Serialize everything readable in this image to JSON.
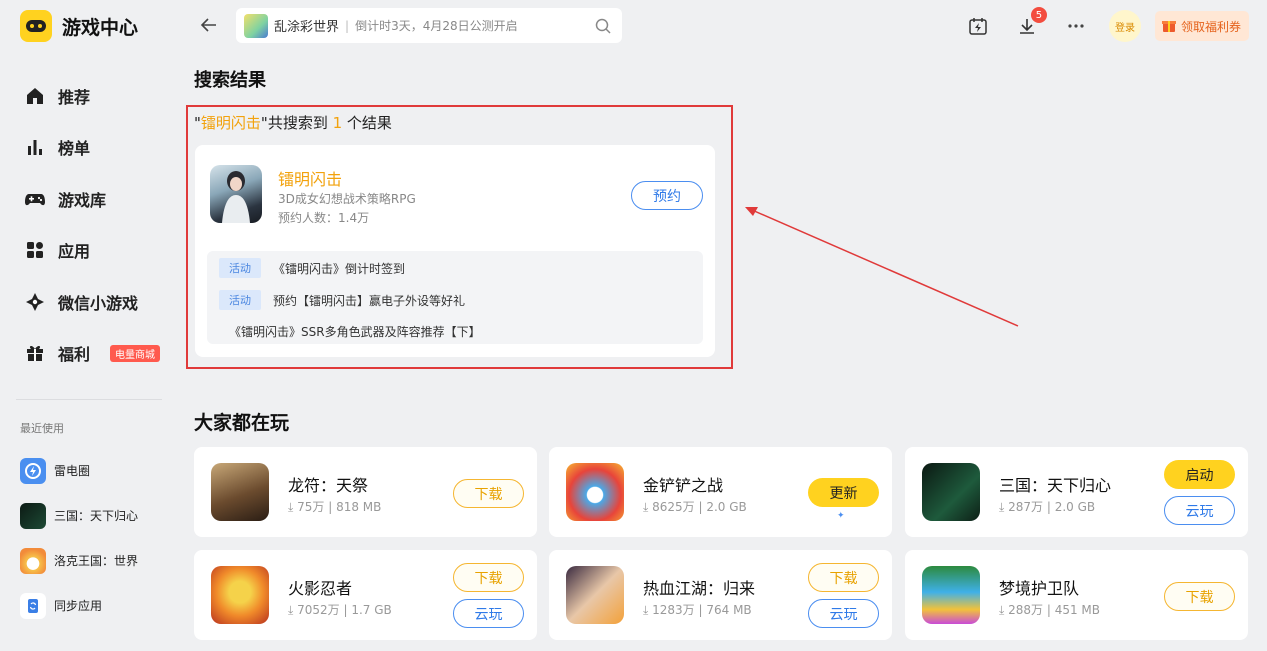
{
  "app": {
    "title": "游戏中心"
  },
  "sidebar": {
    "items": [
      {
        "label": "推荐"
      },
      {
        "label": "榜单"
      },
      {
        "label": "游戏库"
      },
      {
        "label": "应用"
      },
      {
        "label": "微信小游戏"
      },
      {
        "label": "福利",
        "badge": "电量商城"
      }
    ],
    "recent_title": "最近使用",
    "recent": [
      {
        "label": "雷电圈"
      },
      {
        "label": "三国：天下归心"
      },
      {
        "label": "洛克王国：世界"
      },
      {
        "label": "同步应用"
      }
    ]
  },
  "search": {
    "game": "乱涂彩世界",
    "hint": "倒计时3天，4月28日公测开启"
  },
  "topbar": {
    "download_count": "5",
    "login_label": "登录",
    "coupon_label": "领取福利券"
  },
  "results": {
    "title": "搜索结果",
    "summary_prefix": "\"",
    "keyword": "镭明闪击",
    "summary_mid": "\"共搜索到 ",
    "count": "1",
    "summary_suffix": " 个结果",
    "game": {
      "name": "镭明闪击",
      "subtitle": "3D成女幻想战术策略RPG",
      "reservations": "预约人数：1.4万",
      "reserve_label": "预约"
    },
    "activities": [
      {
        "tag": "活动",
        "text": "《镭明闪击》倒计时签到"
      },
      {
        "tag": "活动",
        "text": "预约【镭明闪击】赢电子外设等好礼"
      },
      {
        "tag": "",
        "text": "《镭明闪击》SSR多角色武器及阵容推荐【下】"
      }
    ]
  },
  "popular": {
    "title": "大家都在玩",
    "games": [
      {
        "name": "龙符：天祭",
        "players": "75万",
        "size": "818 MB",
        "primary": "下载",
        "secondary": ""
      },
      {
        "name": "金铲铲之战",
        "players": "8625万",
        "size": "2.0 GB",
        "primary": "更新",
        "secondary": ""
      },
      {
        "name": "三国：天下归心",
        "players": "287万",
        "size": "2.0 GB",
        "primary": "启动",
        "secondary": "云玩"
      },
      {
        "name": "火影忍者",
        "players": "7052万",
        "size": "1.7 GB",
        "primary": "下载",
        "secondary": "云玩"
      },
      {
        "name": "热血江湖：归来",
        "players": "1283万",
        "size": "764 MB",
        "primary": "下载",
        "secondary": "云玩"
      },
      {
        "name": "梦境护卫队",
        "players": "288万",
        "size": "451 MB",
        "primary": "下载",
        "secondary": ""
      }
    ]
  },
  "colors": {
    "accent": "#ffd21f",
    "highlight": "#f2a20d",
    "blue": "#2f7ae8",
    "annotation": "#e03a3a"
  }
}
